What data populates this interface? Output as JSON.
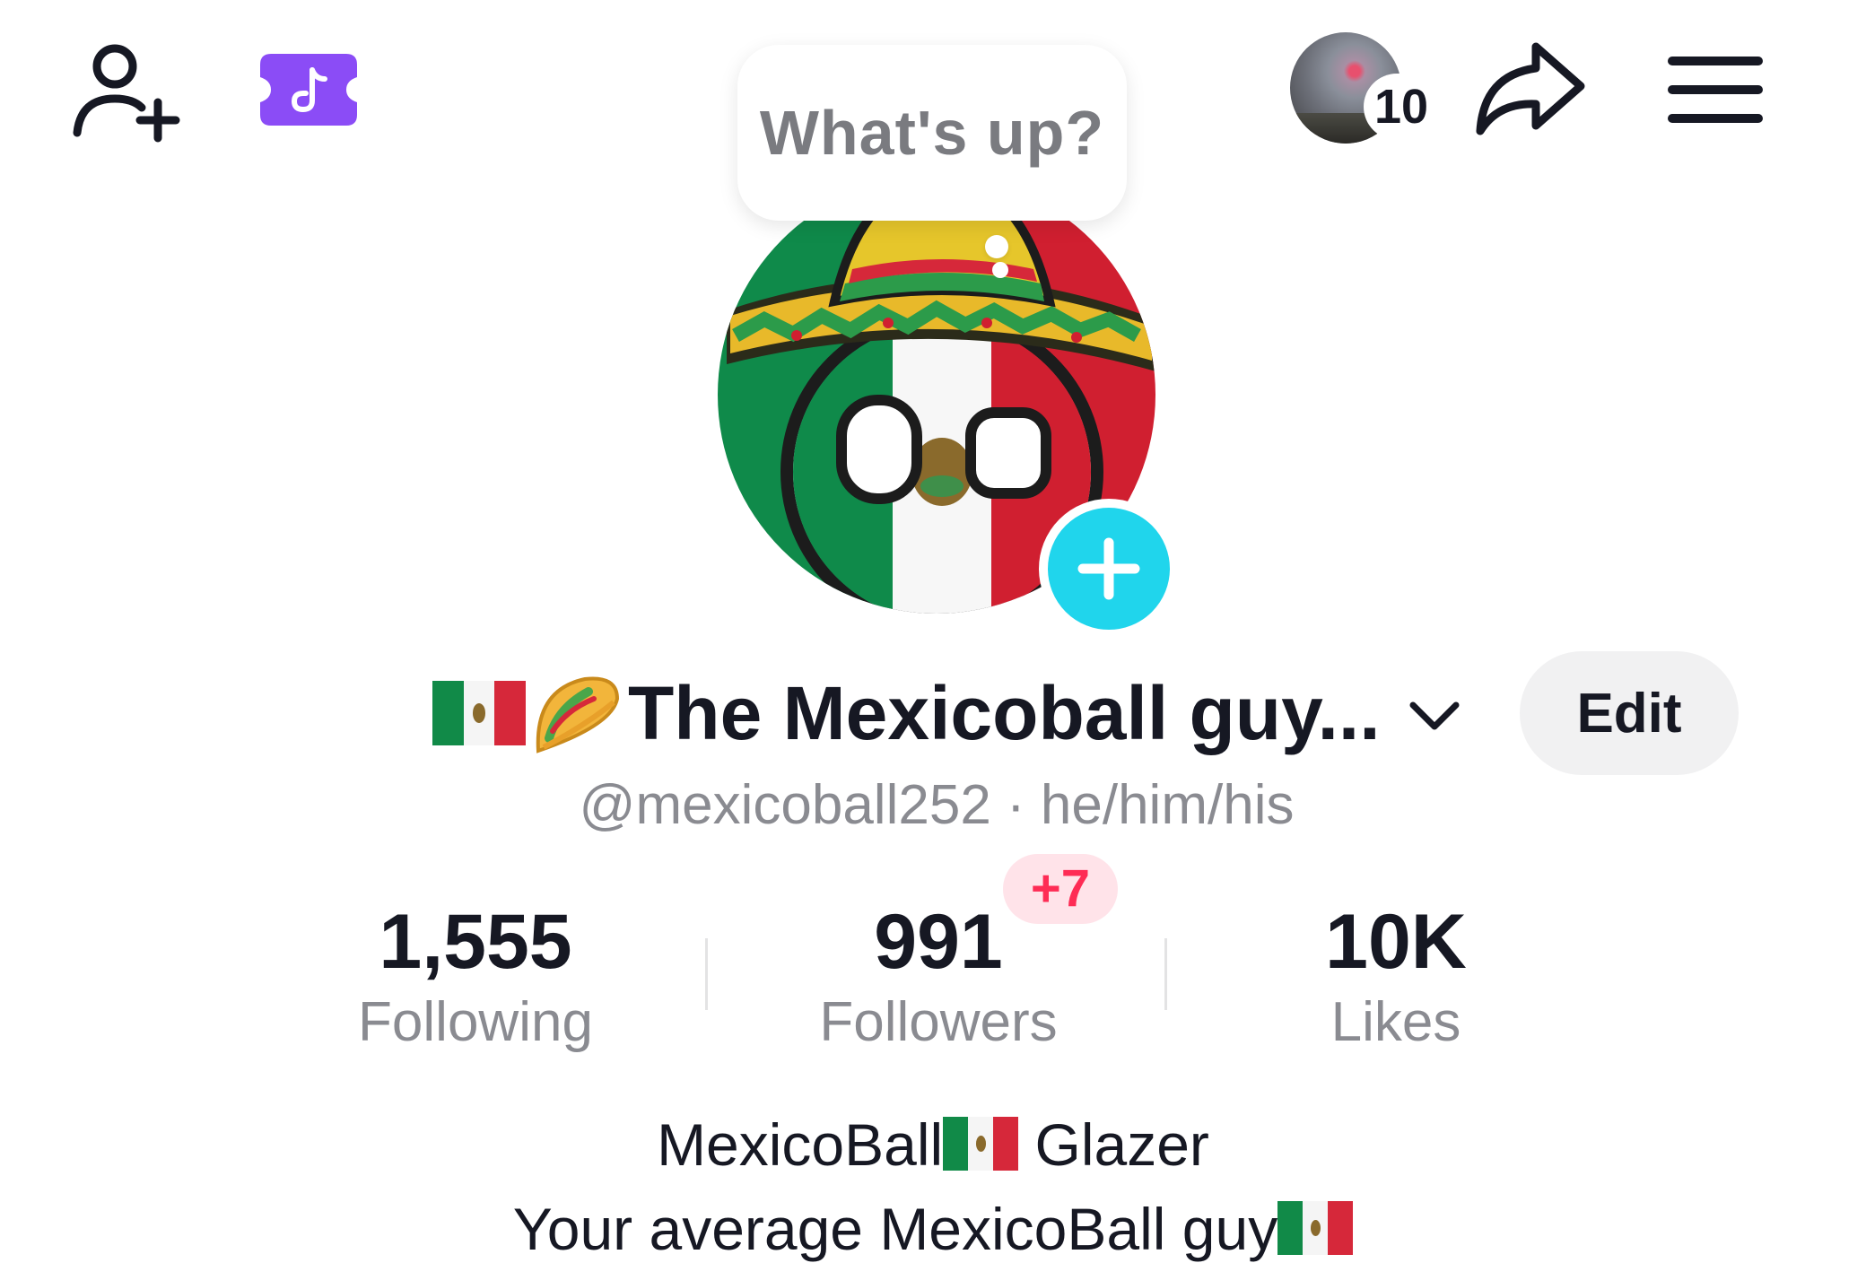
{
  "header": {
    "add_friend_icon": "person-add-icon",
    "ticket_icon": "tiktok-ticket-icon",
    "story_count": "10",
    "share_icon": "share-arrow-icon",
    "menu_icon": "hamburger-menu-icon"
  },
  "bubble": {
    "text": "What's up?"
  },
  "profile": {
    "display_name": "The Mexicoball guy...",
    "name_emojis": [
      "mexico-flag",
      "taco"
    ],
    "handle": "@mexicoball252 · he/him/his",
    "edit_label": "Edit"
  },
  "stats": {
    "following": {
      "value": "1,555",
      "label": "Following"
    },
    "followers": {
      "value": "991",
      "label": "Followers",
      "new_badge": "+7"
    },
    "likes": {
      "value": "10K",
      "label": "Likes"
    }
  },
  "bio": {
    "line1_start": "MexicoBall",
    "line1_end": " Glazer",
    "line2": "Your average MexicoBall guy"
  },
  "colors": {
    "accent_cyan": "#20d5ec",
    "badge_red": "#fe2c55",
    "ticket_purple": "#8b4cf6",
    "text_primary": "#161823",
    "text_secondary": "#8a8b91"
  }
}
